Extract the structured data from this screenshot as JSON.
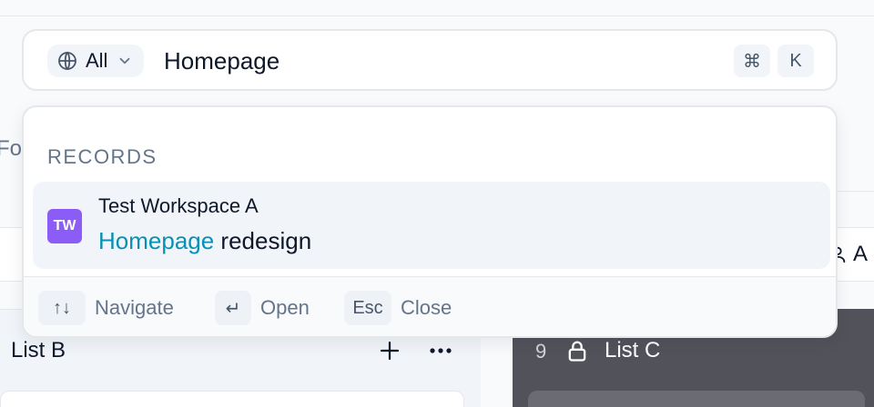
{
  "background": {
    "partial_left_text": "Fo",
    "partial_right_text": "A",
    "column_b": {
      "title": "List B"
    },
    "column_c": {
      "count": "9",
      "title": "List C"
    }
  },
  "search": {
    "scope_label": "All",
    "query": "Homepage",
    "shortcut_keys": [
      "⌘",
      "K"
    ]
  },
  "results": {
    "section_label": "RECORDS",
    "items": [
      {
        "workspace_initials": "TW",
        "workspace_name": "Test Workspace A",
        "title_match": "Homepage",
        "title_rest": " redesign"
      }
    ]
  },
  "footer_hints": {
    "navigate": {
      "key": "↑↓",
      "label": "Navigate"
    },
    "open": {
      "key": "↵",
      "label": "Open"
    },
    "close": {
      "key": "Esc",
      "label": "Close"
    }
  },
  "colors": {
    "highlight": "#0891b2",
    "avatar": "#8b5cf6",
    "column_c_bg": "#52525b"
  }
}
